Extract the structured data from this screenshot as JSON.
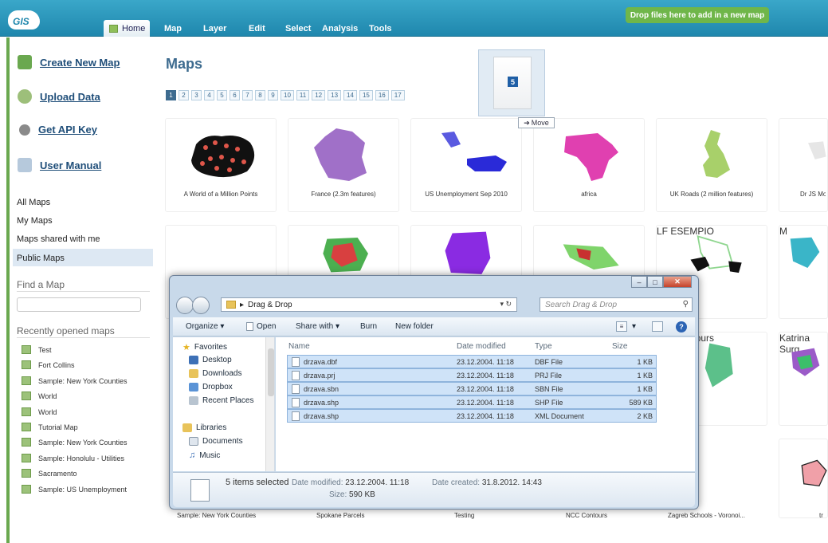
{
  "topbar": {
    "logo_text": "GIS",
    "home_tab": "Home",
    "menu": [
      "Map",
      "Layer",
      "Edit",
      "Select",
      "Analysis",
      "Tools"
    ],
    "drop_banner": "Drop files here to add in a new map"
  },
  "sidebar": {
    "links": [
      {
        "label": "Create New Map",
        "icon": "create-map-icon"
      },
      {
        "label": "Upload Data",
        "icon": "upload-icon"
      },
      {
        "label": "Get API Key",
        "icon": "gear-icon"
      },
      {
        "label": "User Manual",
        "icon": "manual-icon"
      }
    ],
    "nav": [
      "All Maps",
      "My Maps",
      "Maps shared with me",
      "Public Maps"
    ],
    "find_header": "Find a Map",
    "recent_header": "Recently opened maps",
    "recent": [
      "Test",
      "Fort Collins",
      "Sample: New York Counties",
      "World",
      "World",
      "Tutorial Map",
      "Sample: New York Counties",
      "Sample: Honolulu - Utilities",
      "Sacramento",
      "Sample: US Unemployment"
    ]
  },
  "main": {
    "title": "Maps",
    "pages": [
      "1",
      "2",
      "3",
      "4",
      "5",
      "6",
      "7",
      "8",
      "9",
      "10",
      "11",
      "12",
      "13",
      "14",
      "15",
      "16",
      "17"
    ],
    "row1": [
      "A World of a Million Points",
      "France (2.3m features)",
      "US Unemployment Sep 2010",
      "africa",
      "UK Roads (2 million features)",
      "Dr JS Mo"
    ],
    "row2_visible": [
      "LF ESEMPIO",
      "M"
    ],
    "row3_visible": [
      "ane Contours",
      "Katrina Surg"
    ],
    "bottom": [
      "Sample: New York Counties",
      "Spokane Parcels",
      "Testing",
      "NCC Contours",
      "Zagreb Schools - Voronoi...",
      "tr"
    ]
  },
  "drag": {
    "count": "5",
    "tip": "Move"
  },
  "explorer": {
    "address": "Drag & Drop",
    "search_placeholder": "Search Drag & Drop",
    "toolbar": [
      "Organize",
      "Open",
      "Share with",
      "Burn",
      "New folder"
    ],
    "nav": {
      "favorites": "Favorites",
      "fav_items": [
        "Desktop",
        "Downloads",
        "Dropbox",
        "Recent Places"
      ],
      "libraries": "Libraries",
      "lib_items": [
        "Documents",
        "Music"
      ]
    },
    "columns": [
      "Name",
      "Date modified",
      "Type",
      "Size"
    ],
    "files": [
      {
        "name": "drzava.dbf",
        "date": "23.12.2004. 11:18",
        "type": "DBF File",
        "size": "1 KB"
      },
      {
        "name": "drzava.prj",
        "date": "23.12.2004. 11:18",
        "type": "PRJ File",
        "size": "1 KB"
      },
      {
        "name": "drzava.sbn",
        "date": "23.12.2004. 11:18",
        "type": "SBN File",
        "size": "1 KB"
      },
      {
        "name": "drzava.shp",
        "date": "23.12.2004. 11:18",
        "type": "SHP File",
        "size": "589 KB"
      },
      {
        "name": "drzava.shp",
        "date": "23.12.2004. 11:18",
        "type": "XML Document",
        "size": "2 KB"
      }
    ],
    "details": {
      "selected": "5 items selected",
      "modified_label": "Date modified:",
      "modified_value": "23.12.2004. 11:18",
      "created_label": "Date created:",
      "created_value": "31.8.2012. 14:43",
      "size_label": "Size:",
      "size_value": "590 KB"
    }
  }
}
